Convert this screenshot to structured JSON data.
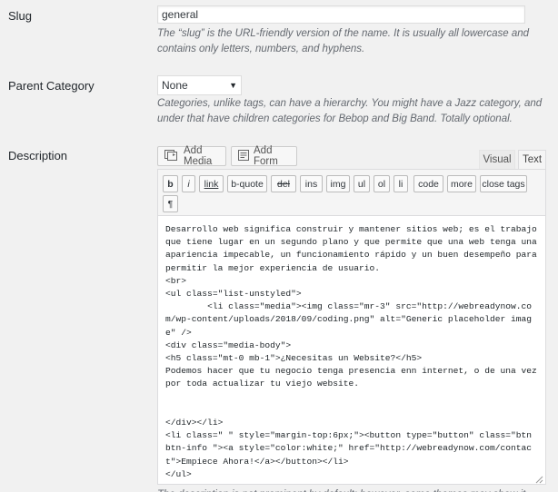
{
  "slug": {
    "label": "Slug",
    "value": "general",
    "help": "The “slug” is the URL-friendly version of the name. It is usually all lowercase and contains only letters, numbers, and hyphens."
  },
  "parent": {
    "label": "Parent Category",
    "selected": "None",
    "help": "Categories, unlike tags, can have a hierarchy. You might have a Jazz category, and under that have children categories for Bebop and Big Band. Totally optional."
  },
  "description": {
    "label": "Description",
    "add_media": "Add Media",
    "add_form": "Add Form",
    "tabs": {
      "visual": "Visual",
      "text": "Text"
    },
    "quicktags": [
      "b",
      "i",
      "link",
      "b-quote",
      "del",
      "ins",
      "img",
      "ul",
      "ol",
      "li",
      "code",
      "more",
      "close tags",
      "¶"
    ],
    "content": "Desarrollo web significa construir y mantener sitios web; es el trabajo que tiene lugar en un segundo plano y que permite que una web tenga una apariencia impecable, un funcionamiento rápido y un buen desempeño para permitir la mejor experiencia de usuario.\n<br>\n<ul class=\"list-unstyled\">\n        <li class=\"media\"><img class=\"mr-3\" src=\"http://webreadynow.com/wp-content/uploads/2018/09/coding.png\" alt=\"Generic placeholder image\" />\n<div class=\"media-body\">\n<h5 class=\"mt-0 mb-1\">¿Necesitas un Website?</h5>\nPodemos hacer que tu negocio tenga presencia enn internet, o de una vez por toda actualizar tu viejo website.\n\n\n</div></li>\n<li class=\" \" style=\"margin-top:6px;\"><button type=\"button\" class=\"btn btn-info \"><a style=\"color:white;\" href=\"http://webreadynow.com/contact\">Empiece Ahora!</a></button></li>\n</ul>",
    "bottom_help": "The description is not prominent by default; however, some themes may show it."
  },
  "icons": {
    "add_media": "media-icon",
    "add_form": "form-icon",
    "resize": "resize-handle-icon",
    "select": "chevron-down-icon"
  }
}
